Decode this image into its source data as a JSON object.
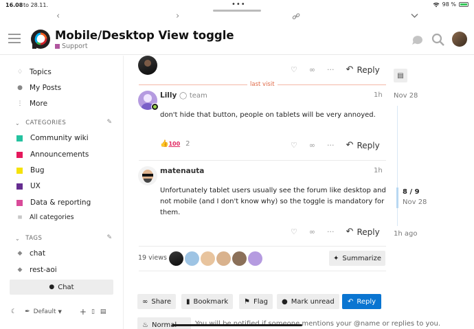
{
  "status_bar": {
    "time": "16.08",
    "date": "to 28.11.",
    "battery": "98 %"
  },
  "header": {
    "title": "Mobile/Desktop View toggle",
    "category": "Support",
    "category_color": "#b0569e"
  },
  "sidebar": {
    "nav": [
      {
        "label": "Topics",
        "icon": "topics-icon"
      },
      {
        "label": "My Posts",
        "icon": "user-icon"
      },
      {
        "label": "More",
        "icon": "more-vertical-icon"
      }
    ],
    "categories_heading": "CATEGORIES",
    "categories": [
      {
        "label": "Community wiki",
        "color": "#25c2a0"
      },
      {
        "label": "Announcements",
        "color": "#e5185c"
      },
      {
        "label": "Bug",
        "color": "#f5e20a"
      },
      {
        "label": "UX",
        "color": "#652d90"
      },
      {
        "label": "Data & reporting",
        "color": "#d94b99"
      }
    ],
    "all_categories": "All categories",
    "tags_heading": "TAGS",
    "tags": [
      "chat",
      "rest-aoi"
    ],
    "chat_button": "Chat",
    "theme_label": "Default"
  },
  "posts": {
    "top_post": {
      "reply_label": "Reply"
    },
    "last_visit": "last visit",
    "post1": {
      "username": "Lilly",
      "user_title": "team",
      "time": "1h",
      "body": "don't hide that button, people on tablets will be very annoyed.",
      "reaction_count": "2",
      "reply_label": "Reply"
    },
    "post2": {
      "username": "matenauta",
      "time": "1h",
      "body": "Unfortunately tablet users usually see the forum like desktop and not mobile (and I don't know why) so the toggle is mandatory for them.",
      "reply_label": "Reply"
    },
    "footer": {
      "views": "19 views",
      "summarize": "Summarize"
    }
  },
  "actions": {
    "share": "Share",
    "bookmark": "Bookmark",
    "flag": "Flag",
    "mark_unread": "Mark unread",
    "reply": "Reply"
  },
  "notification": {
    "level": "Normal",
    "text": "You will be notified if someone mentions your @name or replies to you."
  },
  "timeline": {
    "top_date": "Nov 28",
    "position": "8 / 9",
    "position_date": "Nov 28",
    "bottom": "1h ago"
  }
}
